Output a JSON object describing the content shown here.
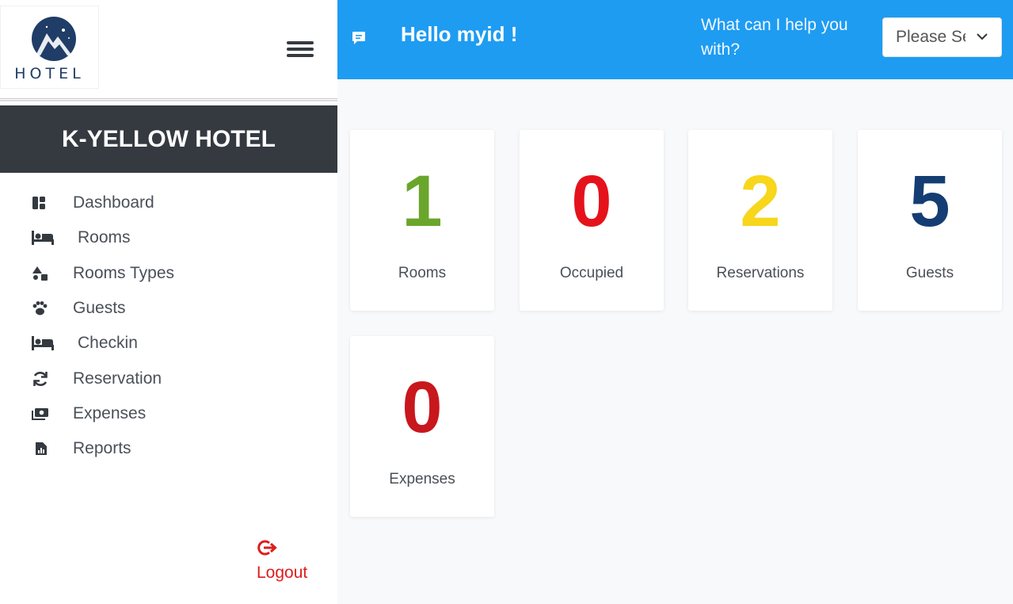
{
  "sidebar": {
    "logo_text": "HOTEL",
    "hotel_name": "K-YELLOW HOTEL",
    "items": [
      {
        "label": "Dashboard",
        "icon": "dashboard-icon"
      },
      {
        "label": "Rooms",
        "icon": "bed-icon"
      },
      {
        "label": "Rooms Types",
        "icon": "shapes-icon"
      },
      {
        "label": "Guests",
        "icon": "paw-icon"
      },
      {
        "label": "Checkin",
        "icon": "bed-icon"
      },
      {
        "label": "Reservation",
        "icon": "sync-icon"
      },
      {
        "label": "Expenses",
        "icon": "money-icon"
      },
      {
        "label": "Reports",
        "icon": "report-file-icon"
      }
    ],
    "logout_label": "Logout"
  },
  "header": {
    "greeting": "Hello myid !",
    "help_text": "What can I help you with?",
    "select_value": "Please Se"
  },
  "stats": [
    {
      "value": "1",
      "label": "Rooms",
      "color": "#6aa62b"
    },
    {
      "value": "0",
      "label": "Occupied",
      "color": "#e5121b"
    },
    {
      "value": "2",
      "label": "Reservations",
      "color": "#f7d61b"
    },
    {
      "value": "5",
      "label": "Guests",
      "color": "#143d73"
    },
    {
      "value": "0",
      "label": "Expenses",
      "color": "#c8171d"
    }
  ],
  "colors": {
    "header_bg": "#1e9cf2",
    "banner_bg": "#343a40",
    "logout": "#dc1e1e"
  }
}
